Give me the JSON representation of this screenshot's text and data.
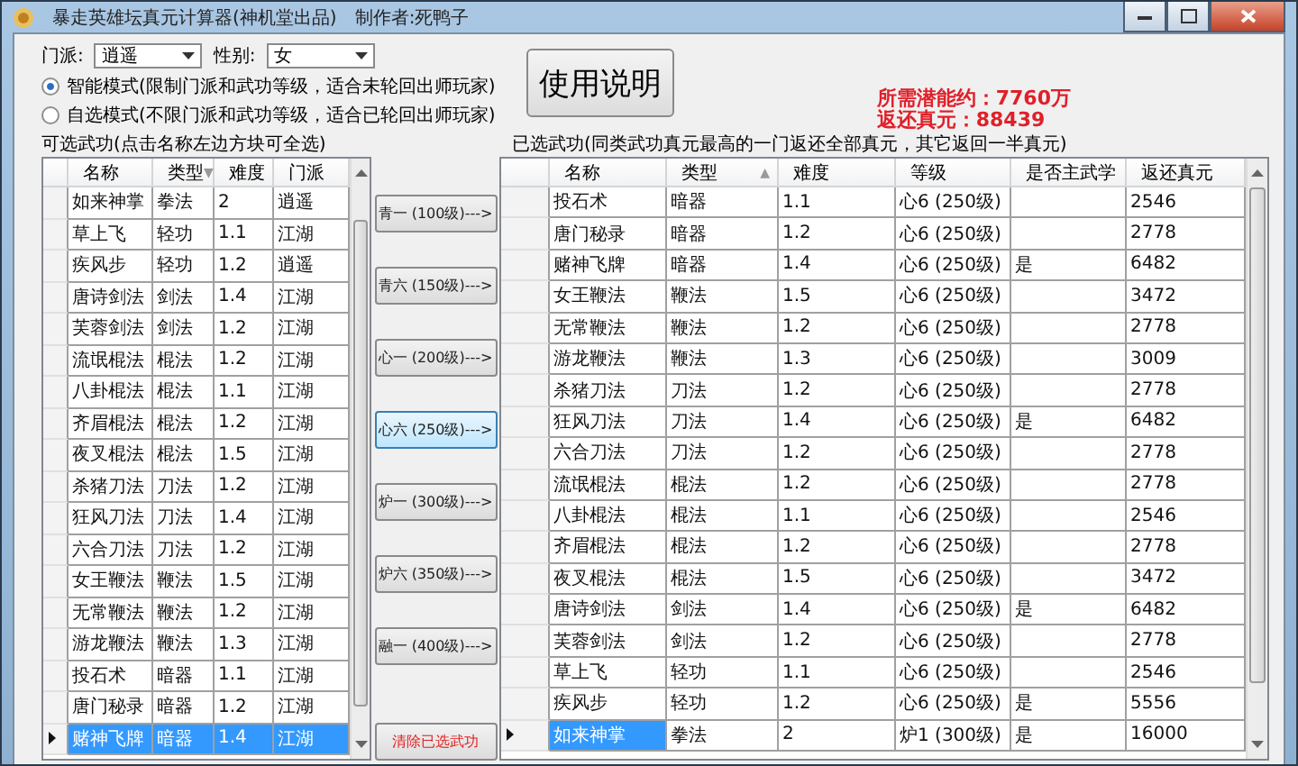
{
  "window": {
    "title": "暴走英雄坛真元计算器(神机堂出品)",
    "author": "制作者:死鸭子"
  },
  "filters": [
    {
      "label": "门派:",
      "value": "逍遥"
    },
    {
      "label": "性别:",
      "value": "女"
    }
  ],
  "modes": [
    {
      "label": "智能模式(限制门派和武功等级，适合未轮回出师玩家)",
      "selected": true
    },
    {
      "label": "自选模式(不限门派和武功等级，适合已轮回出师玩家)",
      "selected": false
    }
  ],
  "help_button": "使用说明",
  "summary": {
    "potential": "所需潜能约：7760万",
    "returned": "返还真元：88439"
  },
  "available": {
    "label": "可选武功(点击名称左边方块可全选)",
    "columns": [
      {
        "label": "名称"
      },
      {
        "label": "类型",
        "sort_arrow": "▼"
      },
      {
        "label": "难度"
      },
      {
        "label": "门派"
      }
    ],
    "rows": [
      {
        "cells": [
          "如来神掌",
          "拳法",
          "2",
          "逍遥"
        ],
        "selected": false
      },
      {
        "cells": [
          "草上飞",
          "轻功",
          "1.1",
          "江湖"
        ],
        "selected": false
      },
      {
        "cells": [
          "疾风步",
          "轻功",
          "1.2",
          "逍遥"
        ],
        "selected": false
      },
      {
        "cells": [
          "唐诗剑法",
          "剑法",
          "1.4",
          "江湖"
        ],
        "selected": false
      },
      {
        "cells": [
          "芙蓉剑法",
          "剑法",
          "1.2",
          "江湖"
        ],
        "selected": false
      },
      {
        "cells": [
          "流氓棍法",
          "棍法",
          "1.2",
          "江湖"
        ],
        "selected": false
      },
      {
        "cells": [
          "八卦棍法",
          "棍法",
          "1.1",
          "江湖"
        ],
        "selected": false
      },
      {
        "cells": [
          "齐眉棍法",
          "棍法",
          "1.2",
          "江湖"
        ],
        "selected": false
      },
      {
        "cells": [
          "夜叉棍法",
          "棍法",
          "1.5",
          "江湖"
        ],
        "selected": false
      },
      {
        "cells": [
          "杀猪刀法",
          "刀法",
          "1.2",
          "江湖"
        ],
        "selected": false
      },
      {
        "cells": [
          "狂风刀法",
          "刀法",
          "1.4",
          "江湖"
        ],
        "selected": false
      },
      {
        "cells": [
          "六合刀法",
          "刀法",
          "1.2",
          "江湖"
        ],
        "selected": false
      },
      {
        "cells": [
          "女王鞭法",
          "鞭法",
          "1.5",
          "江湖"
        ],
        "selected": false
      },
      {
        "cells": [
          "无常鞭法",
          "鞭法",
          "1.2",
          "江湖"
        ],
        "selected": false
      },
      {
        "cells": [
          "游龙鞭法",
          "鞭法",
          "1.3",
          "江湖"
        ],
        "selected": false
      },
      {
        "cells": [
          "投石术",
          "暗器",
          "1.1",
          "江湖"
        ],
        "selected": false
      },
      {
        "cells": [
          "唐门秘录",
          "暗器",
          "1.2",
          "江湖"
        ],
        "selected": false
      },
      {
        "cells": [
          "赌神飞牌",
          "暗器",
          "1.4",
          "江湖"
        ],
        "selected": true
      }
    ]
  },
  "actions": [
    {
      "label": "青一 (100级)--->",
      "kind": "level",
      "focused": false
    },
    {
      "label": "青六 (150级)--->",
      "kind": "level",
      "focused": false
    },
    {
      "label": "心一 (200级)--->",
      "kind": "level",
      "focused": false
    },
    {
      "label": "心六 (250级)--->",
      "kind": "level",
      "focused": true
    },
    {
      "label": "炉一 (300级)--->",
      "kind": "level",
      "focused": false
    },
    {
      "label": "炉六 (350级)--->",
      "kind": "level",
      "focused": false
    },
    {
      "label": "融一 (400级)--->",
      "kind": "level",
      "focused": false
    },
    {
      "label": "清除已选武功",
      "kind": "clear",
      "focused": false
    }
  ],
  "chosen": {
    "label": "已选武功(同类武功真元最高的一门返还全部真元，其它返回一半真元)",
    "columns": [
      {
        "label": "名称"
      },
      {
        "label": "类型",
        "sort_arrow": "▲"
      },
      {
        "label": "难度"
      },
      {
        "label": "等级"
      },
      {
        "label": "是否主武学"
      },
      {
        "label": "返还真元"
      }
    ],
    "rows": [
      {
        "cells": [
          "投石术",
          "暗器",
          "1.1",
          "心6 (250级)",
          "",
          "2546"
        ],
        "selected": false
      },
      {
        "cells": [
          "唐门秘录",
          "暗器",
          "1.2",
          "心6 (250级)",
          "",
          "2778"
        ],
        "selected": false
      },
      {
        "cells": [
          "赌神飞牌",
          "暗器",
          "1.4",
          "心6 (250级)",
          "是",
          "6482"
        ],
        "selected": false
      },
      {
        "cells": [
          "女王鞭法",
          "鞭法",
          "1.5",
          "心6 (250级)",
          "",
          "3472"
        ],
        "selected": false
      },
      {
        "cells": [
          "无常鞭法",
          "鞭法",
          "1.2",
          "心6 (250级)",
          "",
          "2778"
        ],
        "selected": false
      },
      {
        "cells": [
          "游龙鞭法",
          "鞭法",
          "1.3",
          "心6 (250级)",
          "",
          "3009"
        ],
        "selected": false
      },
      {
        "cells": [
          "杀猪刀法",
          "刀法",
          "1.2",
          "心6 (250级)",
          "",
          "2778"
        ],
        "selected": false
      },
      {
        "cells": [
          "狂风刀法",
          "刀法",
          "1.4",
          "心6 (250级)",
          "是",
          "6482"
        ],
        "selected": false
      },
      {
        "cells": [
          "六合刀法",
          "刀法",
          "1.2",
          "心6 (250级)",
          "",
          "2778"
        ],
        "selected": false
      },
      {
        "cells": [
          "流氓棍法",
          "棍法",
          "1.2",
          "心6 (250级)",
          "",
          "2778"
        ],
        "selected": false
      },
      {
        "cells": [
          "八卦棍法",
          "棍法",
          "1.1",
          "心6 (250级)",
          "",
          "2546"
        ],
        "selected": false
      },
      {
        "cells": [
          "齐眉棍法",
          "棍法",
          "1.2",
          "心6 (250级)",
          "",
          "2778"
        ],
        "selected": false
      },
      {
        "cells": [
          "夜叉棍法",
          "棍法",
          "1.5",
          "心6 (250级)",
          "",
          "3472"
        ],
        "selected": false
      },
      {
        "cells": [
          "唐诗剑法",
          "剑法",
          "1.4",
          "心6 (250级)",
          "是",
          "6482"
        ],
        "selected": false
      },
      {
        "cells": [
          "芙蓉剑法",
          "剑法",
          "1.2",
          "心6 (250级)",
          "",
          "2778"
        ],
        "selected": false
      },
      {
        "cells": [
          "草上飞",
          "轻功",
          "1.1",
          "心6 (250级)",
          "",
          "2546"
        ],
        "selected": false
      },
      {
        "cells": [
          "疾风步",
          "轻功",
          "1.2",
          "心6 (250级)",
          "是",
          "5556"
        ],
        "selected": false
      },
      {
        "cells": [
          "如来神掌",
          "拳法",
          "2",
          "炉1 (300级)",
          "是",
          "16000"
        ],
        "selected": true
      }
    ]
  }
}
